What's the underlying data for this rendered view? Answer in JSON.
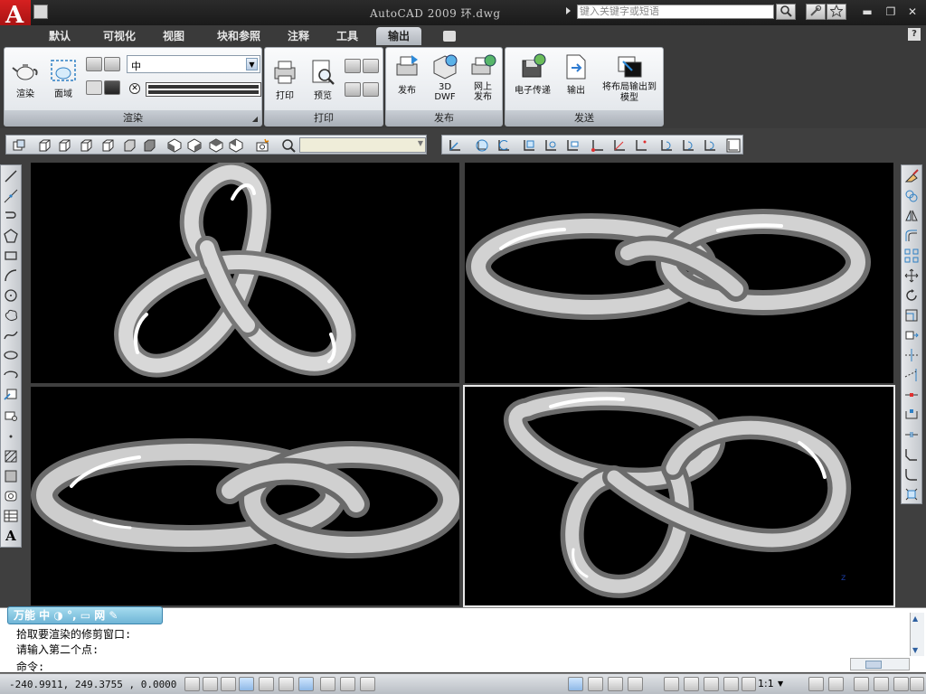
{
  "app": {
    "logo_letter": "A",
    "title": "AutoCAD 2009  环.dwg",
    "search_placeholder": "键入关键字或短语"
  },
  "tabs": [
    {
      "label": "默认",
      "active": false
    },
    {
      "label": "可视化",
      "active": false
    },
    {
      "label": "视图",
      "active": false
    },
    {
      "label": "块和参照",
      "active": false
    },
    {
      "label": "注释",
      "active": false
    },
    {
      "label": "工具",
      "active": false
    },
    {
      "label": "输出",
      "active": true
    }
  ],
  "ribbon": {
    "render_panel": {
      "title": "渲染",
      "render_label": "渲染",
      "region_label": "面域",
      "quality_value": "中"
    },
    "print_panel": {
      "title": "打印",
      "print_label": "打印",
      "preview_label": "预览"
    },
    "publish_panel": {
      "title": "发布",
      "publish_label": "发布",
      "dwf3d_label_line1": "3D",
      "dwf3d_label_line2": "DWF",
      "web_label_line1": "网上",
      "web_label_line2": "发布"
    },
    "send_panel": {
      "title": "发送",
      "etransmit_label": "电子传递",
      "export_label": "输出",
      "layout_to_model_line1": "将布局输出到",
      "layout_to_model_line2": "模型"
    }
  },
  "ime": {
    "label": "万能 中 ◑ °, ▭ 网 ✎"
  },
  "command": {
    "history_line1": "拾取要渲染的修剪窗口:",
    "history_line2": "请输入第二个点:",
    "prompt": "命令:"
  },
  "status": {
    "coordinates": "-240.9911, 249.3755 , 0.0000",
    "annotation_scale": "1:1"
  },
  "colors": {
    "logo_red": "#c41a1a",
    "viewport_bg": "#000000",
    "ribbon_panel": "#e8ebee"
  }
}
